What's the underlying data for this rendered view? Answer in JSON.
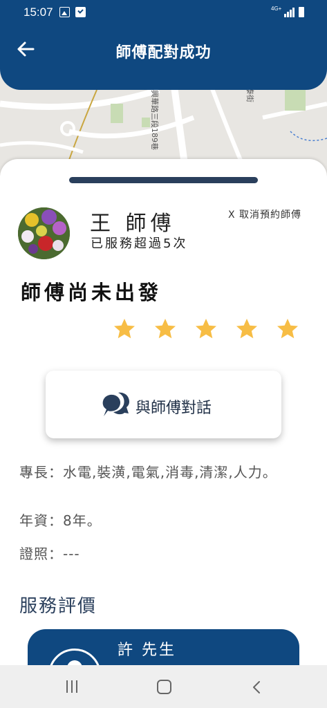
{
  "status_bar": {
    "time": "15:07",
    "network_label": "4G+",
    "icons": [
      "gallery-icon",
      "download-icon",
      "signal-icon",
      "battery-icon"
    ]
  },
  "header": {
    "title": "師傅配對成功",
    "back_icon": "arrow-left-icon"
  },
  "map": {
    "road_labels": [
      "興華路三段189巷",
      "泰街"
    ]
  },
  "master": {
    "name": "王 師傅",
    "service_count": "已服務超過5次",
    "cancel_label": "X  取消預約師傅",
    "status": "師傅尚未出發",
    "rating": 5,
    "rating_max": 5
  },
  "chat_button": {
    "label": "與師傅對話",
    "icon": "chat-bubbles-icon"
  },
  "details": {
    "skills": "專長：水電,裝潢,電氣,消毒,清潔,人力。",
    "experience": "年資：8年。",
    "license": "證照：---"
  },
  "reviews": {
    "heading": "服務評價",
    "items": [
      {
        "name": "許 先生"
      }
    ]
  },
  "nav_bar": {
    "icons": [
      "recents-icon",
      "home-icon",
      "back-icon"
    ]
  },
  "colors": {
    "primary": "#0f4880",
    "star": "#f7bd45",
    "dark_text": "#2a3f5c"
  }
}
